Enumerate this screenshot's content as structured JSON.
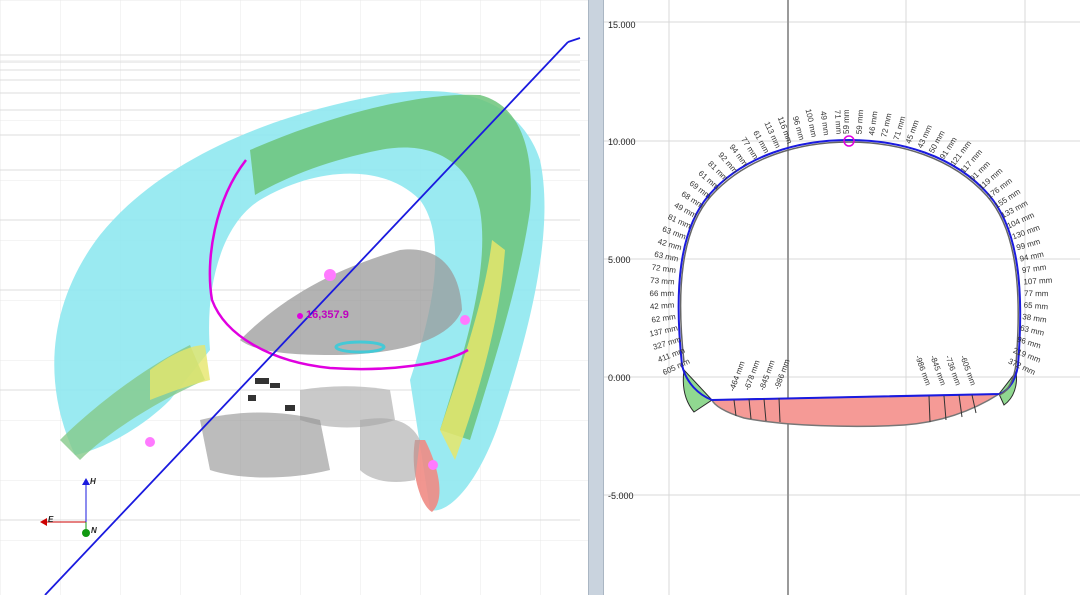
{
  "viewer3d": {
    "station_label": "16,357.9",
    "axes": {
      "east": "E",
      "north": "N",
      "height": "H"
    },
    "colors": {
      "alignment": "#1a1adf",
      "profile": "#e000e0",
      "axis_east": "#cc0000",
      "axis_north": "#119911",
      "axis_height": "#1a1adf"
    }
  },
  "section": {
    "y_ticks": [
      "15.000",
      "10.000",
      "5.000",
      "0.000",
      "-5.000"
    ],
    "crown_labels": [
      "605 mm",
      "411 mm",
      "327 mm",
      "137 mm",
      "62 mm",
      "42 mm",
      "66 mm",
      "73 mm",
      "72 mm",
      "63 mm",
      "42 mm",
      "63 mm",
      "81 mm",
      "49 mm",
      "68 mm",
      "69 mm",
      "61 mm",
      "81 mm",
      "92 mm",
      "94 mm",
      "77 mm",
      "61 mm",
      "113 mm",
      "116 mm",
      "96 mm",
      "100 mm",
      "49 mm",
      "71 mm",
      "59 mm",
      "59 mm",
      "46 mm",
      "72 mm",
      "71 mm",
      "45 mm",
      "43 mm",
      "50 mm",
      "91 mm",
      "121 mm",
      "117 mm",
      "91 mm",
      "119 mm",
      "176 mm",
      "155 mm",
      "133 mm",
      "104 mm",
      "130 mm",
      "99 mm",
      "94 mm",
      "97 mm",
      "107 mm",
      "77 mm",
      "65 mm",
      "38 mm",
      "63 mm",
      "96 mm",
      "219 mm",
      "372 mm"
    ],
    "invert_labels_left": [
      "-464 mm",
      "-678 mm",
      "-845 mm",
      "-986 mm"
    ],
    "invert_labels_right": [
      "-986 mm",
      "-845 mm",
      "-736 mm",
      "-605 mm"
    ],
    "colors": {
      "design": "#1a1adf",
      "scan": "#777777",
      "underbreak": "#f59a96",
      "overbreak": "#90d890",
      "marker": "#e000e0"
    }
  }
}
